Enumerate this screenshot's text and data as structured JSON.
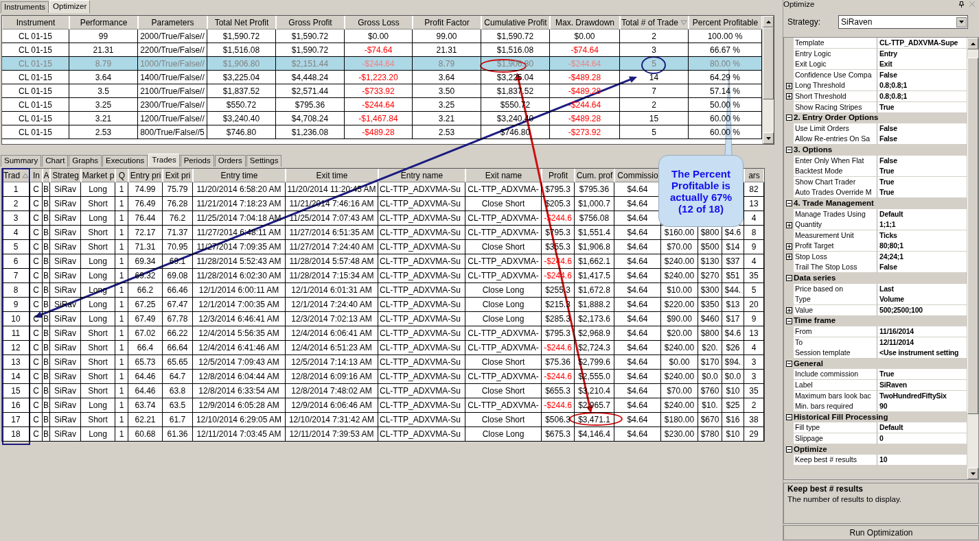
{
  "main_tabs": [
    {
      "label": "Instruments",
      "selected": false
    },
    {
      "label": "Optimizer",
      "selected": true
    }
  ],
  "results_table": {
    "columns": [
      {
        "label": "Instrument"
      },
      {
        "label": "Performance"
      },
      {
        "label": "Parameters"
      },
      {
        "label": "Total Net Profit"
      },
      {
        "label": "Gross Profit"
      },
      {
        "label": "Gross Loss"
      },
      {
        "label": "Profit Factor"
      },
      {
        "label": "Cumulative Profit"
      },
      {
        "label": "Max. Drawdown"
      },
      {
        "label": "Total # of Trade",
        "sort_descending": true
      },
      {
        "label": "Percent Profitable"
      }
    ],
    "rows": [
      {
        "selected": false,
        "cells": [
          "CL 01-15",
          "99",
          "2000/True/False//",
          "$1,590.72",
          "$1,590.72",
          "$0.00",
          "99.00",
          "$1,590.72",
          "$0.00",
          "2",
          "100.00 %"
        ]
      },
      {
        "selected": false,
        "cells": [
          "CL 01-15",
          "21.31",
          "2200/True/False//",
          "$1,516.08",
          "$1,590.72",
          {
            "text": "-$74.64",
            "negative": true
          },
          "21.31",
          "$1,516.08",
          {
            "text": "-$74.64",
            "negative": true
          },
          "3",
          "66.67 %"
        ]
      },
      {
        "selected": true,
        "cells": [
          "CL 01-15",
          "8.79",
          "1000/True/False//",
          "$1,906.80",
          "$2,151.44",
          {
            "text": "-$244.64",
            "negative": true
          },
          "8.79",
          "$1,906.80",
          {
            "text": "-$244.64",
            "negative": true
          },
          "5",
          "80.00 %"
        ]
      },
      {
        "selected": false,
        "cells": [
          "CL 01-15",
          "3.64",
          "1400/True/False//",
          "$3,225.04",
          "$4,448.24",
          {
            "text": "-$1,223.20",
            "negative": true
          },
          "3.64",
          "$3,225.04",
          {
            "text": "-$489.28",
            "negative": true
          },
          "14",
          "64.29 %"
        ]
      },
      {
        "selected": false,
        "cells": [
          "CL 01-15",
          "3.5",
          "2100/True/False//",
          "$1,837.52",
          "$2,571.44",
          {
            "text": "-$733.92",
            "negative": true
          },
          "3.50",
          "$1,837.52",
          {
            "text": "-$489.28",
            "negative": true
          },
          "7",
          "57.14 %"
        ]
      },
      {
        "selected": false,
        "cells": [
          "CL 01-15",
          "3.25",
          "2300/True/False//",
          "$550.72",
          "$795.36",
          {
            "text": "-$244.64",
            "negative": true
          },
          "3.25",
          "$550.72",
          {
            "text": "-$244.64",
            "negative": true
          },
          "2",
          "50.00 %"
        ]
      },
      {
        "selected": false,
        "cells": [
          "CL 01-15",
          "3.21",
          "1200/True/False//",
          "$3,240.40",
          "$4,708.24",
          {
            "text": "-$1,467.84",
            "negative": true
          },
          "3.21",
          "$3,240.40",
          {
            "text": "-$489.28",
            "negative": true
          },
          "15",
          "60.00 %"
        ]
      },
      {
        "selected": false,
        "cells": [
          "CL 01-15",
          "2.53",
          "800/True/False//5",
          "$746.80",
          "$1,236.08",
          {
            "text": "-$489.28",
            "negative": true
          },
          "2.53",
          "$746.80",
          {
            "text": "-$273.92",
            "negative": true
          },
          "5",
          "60.00 %"
        ]
      }
    ]
  },
  "detail_tabs": [
    {
      "label": "Summary",
      "selected": false
    },
    {
      "label": "Chart",
      "selected": false
    },
    {
      "label": "Graphs",
      "selected": false
    },
    {
      "label": "Executions",
      "selected": false
    },
    {
      "label": "Trades",
      "selected": true
    },
    {
      "label": "Periods",
      "selected": false
    },
    {
      "label": "Orders",
      "selected": false
    },
    {
      "label": "Settings",
      "selected": false
    }
  ],
  "trades_table": {
    "columns": [
      {
        "label": "Trad",
        "sort_ascending": true
      },
      {
        "label": "In"
      },
      {
        "label": "A"
      },
      {
        "label": "Strateg"
      },
      {
        "label": "Market p"
      },
      {
        "label": "Q"
      },
      {
        "label": "Entry pri"
      },
      {
        "label": "Exit pri"
      },
      {
        "label": "Entry time"
      },
      {
        "label": "Exit time"
      },
      {
        "label": "Entry name"
      },
      {
        "label": "Exit name"
      },
      {
        "label": "Profit"
      },
      {
        "label": "Cum. prof"
      },
      {
        "label": "Commissio"
      },
      {},
      {},
      {},
      {
        "label": "ars"
      }
    ],
    "rows": [
      [
        "1",
        "C",
        "B",
        "SiRav",
        "Long",
        "1",
        "74.99",
        "75.79",
        "11/20/2014 6:58:20 AM",
        "11/20/2014 11:20:45 AM",
        "CL-TTP_ADXVMA-Su",
        "CL-TTP_ADXVMA-",
        "$795.3",
        "$795.36",
        "$4.64",
        null,
        null,
        null,
        "82"
      ],
      [
        "2",
        "C",
        "B",
        "SiRav",
        "Short",
        "1",
        "76.49",
        "76.28",
        "11/21/2014 7:18:23 AM",
        "11/21/2014 7:46:16 AM",
        "CL-TTP_ADXVMA-Su",
        "Close Short",
        "$205.3",
        "$1,000.7",
        "$4.64",
        null,
        null,
        null,
        "13"
      ],
      [
        "3",
        "C",
        "B",
        "SiRav",
        "Long",
        "1",
        "76.44",
        "76.2",
        "11/25/2014 7:04:18 AM",
        "11/25/2014 7:07:43 AM",
        "CL-TTP_ADXVMA-Su",
        "CL-TTP_ADXVMA-",
        {
          "text": "-$244.6",
          "negative": true
        },
        "$756.08",
        "$4.64",
        null,
        null,
        null,
        "4"
      ],
      [
        "4",
        "C",
        "B",
        "SiRav",
        "Short",
        "1",
        "72.17",
        "71.37",
        "11/27/2014 6:48:11 AM",
        "11/27/2014 6:51:35 AM",
        "CL-TTP_ADXVMA-Su",
        "CL-TTP_ADXVMA-",
        "$795.3",
        "$1,551.4",
        "$4.64",
        "$160.00",
        "$800",
        "$4.6",
        "8"
      ],
      [
        "5",
        "C",
        "B",
        "SiRav",
        "Short",
        "1",
        "71.31",
        "70.95",
        "11/27/2014 7:09:35 AM",
        "11/27/2014 7:24:40 AM",
        "CL-TTP_ADXVMA-Su",
        "Close Short",
        "$355.3",
        "$1,906.8",
        "$4.64",
        "$70.00",
        "$500",
        "$14",
        "9"
      ],
      [
        "6",
        "C",
        "B",
        "SiRav",
        "Long",
        "1",
        "69.34",
        "69.1",
        "11/28/2014 5:52:43 AM",
        "11/28/2014 5:57:48 AM",
        "CL-TTP_ADXVMA-Su",
        "CL-TTP_ADXVMA-",
        {
          "text": "-$244.6",
          "negative": true
        },
        "$1,662.1",
        "$4.64",
        "$240.00",
        "$130",
        "$37",
        "4"
      ],
      [
        "7",
        "C",
        "B",
        "SiRav",
        "Long",
        "1",
        "69.32",
        "69.08",
        "11/28/2014 6:02:30 AM",
        "11/28/2014 7:15:34 AM",
        "CL-TTP_ADXVMA-Su",
        "CL-TTP_ADXVMA-",
        {
          "text": "-$244.6",
          "negative": true
        },
        "$1,417.5",
        "$4.64",
        "$240.00",
        "$270",
        "$51",
        "35"
      ],
      [
        "8",
        "C",
        "B",
        "SiRav",
        "Long",
        "1",
        "66.2",
        "66.46",
        "12/1/2014 6:00:11 AM",
        "12/1/2014 6:01:31 AM",
        "CL-TTP_ADXVMA-Su",
        "Close Long",
        "$255.3",
        "$1,672.8",
        "$4.64",
        "$10.00",
        "$300",
        "$44.",
        "5"
      ],
      [
        "9",
        "C",
        "B",
        "SiRav",
        "Long",
        "1",
        "67.25",
        "67.47",
        "12/1/2014 7:00:35 AM",
        "12/1/2014 7:24:40 AM",
        "CL-TTP_ADXVMA-Su",
        "Close Long",
        "$215.3",
        "$1,888.2",
        "$4.64",
        "$220.00",
        "$350",
        "$13",
        "20"
      ],
      [
        "10",
        "C",
        "B",
        "SiRav",
        "Long",
        "1",
        "67.49",
        "67.78",
        "12/3/2014 6:46:41 AM",
        "12/3/2014 7:02:13 AM",
        "CL-TTP_ADXVMA-Su",
        "Close Long",
        "$285.3",
        "$2,173.6",
        "$4.64",
        "$90.00",
        "$460",
        "$17",
        "9"
      ],
      [
        "11",
        "C",
        "B",
        "SiRav",
        "Short",
        "1",
        "67.02",
        "66.22",
        "12/4/2014 5:56:35 AM",
        "12/4/2014 6:06:41 AM",
        "CL-TTP_ADXVMA-Su",
        "CL-TTP_ADXVMA-",
        "$795.3",
        "$2,968.9",
        "$4.64",
        "$20.00",
        "$800",
        "$4.6",
        "13"
      ],
      [
        "12",
        "C",
        "B",
        "SiRav",
        "Short",
        "1",
        "66.4",
        "66.64",
        "12/4/2014 6:41:46 AM",
        "12/4/2014 6:51:23 AM",
        "CL-TTP_ADXVMA-Su",
        "CL-TTP_ADXVMA-",
        {
          "text": "-$244.6",
          "negative": true
        },
        "$2,724.3",
        "$4.64",
        "$240.00",
        "$20.",
        "$26",
        "4"
      ],
      [
        "13",
        "C",
        "B",
        "SiRav",
        "Short",
        "1",
        "65.73",
        "65.65",
        "12/5/2014 7:09:43 AM",
        "12/5/2014 7:14:13 AM",
        "CL-TTP_ADXVMA-Su",
        "Close Short",
        "$75.36",
        "$2,799.6",
        "$4.64",
        "$0.00",
        "$170",
        "$94.",
        "3"
      ],
      [
        "14",
        "C",
        "B",
        "SiRav",
        "Short",
        "1",
        "64.46",
        "64.7",
        "12/8/2014 6:04:44 AM",
        "12/8/2014 6:09:16 AM",
        "CL-TTP_ADXVMA-Su",
        "CL-TTP_ADXVMA-",
        {
          "text": "-$244.6",
          "negative": true
        },
        "$2,555.0",
        "$4.64",
        "$240.00",
        "$0.0",
        "$0.0",
        "3"
      ],
      [
        "15",
        "C",
        "B",
        "SiRav",
        "Short",
        "1",
        "64.46",
        "63.8",
        "12/8/2014 6:33:54 AM",
        "12/8/2014 7:48:02 AM",
        "CL-TTP_ADXVMA-Su",
        "Close Short",
        "$655.3",
        "$3,210.4",
        "$4.64",
        "$70.00",
        "$760",
        "$10",
        "35"
      ],
      [
        "16",
        "C",
        "B",
        "SiRav",
        "Long",
        "1",
        "63.74",
        "63.5",
        "12/9/2014 6:05:28 AM",
        "12/9/2014 6:06:46 AM",
        "CL-TTP_ADXVMA-Su",
        "CL-TTP_ADXVMA-",
        {
          "text": "-$244.6",
          "negative": true
        },
        "$2,965.7",
        "$4.64",
        "$240.00",
        "$10.",
        "$25",
        "2"
      ],
      [
        "17",
        "C",
        "B",
        "SiRav",
        "Short",
        "1",
        "62.21",
        "61.7",
        "12/10/2014 6:29:05 AM",
        "12/10/2014 7:31:42 AM",
        "CL-TTP_ADXVMA-Su",
        "Close Short",
        "$506.3",
        "$3,471.1",
        "$4.64",
        "$180.00",
        "$670",
        "$16",
        "38"
      ],
      [
        "18",
        "C",
        "B",
        "SiRav",
        "Long",
        "1",
        "60.68",
        "61.36",
        "12/11/2014 7:03:45 AM",
        "12/11/2014 7:39:53 AM",
        "CL-TTP_ADXVMA-Su",
        "Close Long",
        "$675.3",
        "$4,146.4",
        "$4.64",
        "$230.00",
        "$780",
        "$10",
        "29"
      ]
    ]
  },
  "callout": {
    "text": "The Percent Profitable is actually 67% (12 of 18)"
  },
  "optimize_panel": {
    "title": "Optimize",
    "strategy_label": "Strategy:",
    "strategy_value": "SiRaven",
    "top_items": [
      {
        "name": "Template",
        "value": "CL-TTP_ADXVMA-Supe",
        "expandable": false
      },
      {
        "name": "Entry Logic",
        "value": "Entry",
        "expandable": false
      },
      {
        "name": "Exit Logic",
        "value": "Exit",
        "expandable": false
      },
      {
        "name": "Confidence Use Compa",
        "value": "False",
        "expandable": false
      },
      {
        "name": "Long Threshold",
        "value": "0.8;0.8;1",
        "expandable": true
      },
      {
        "name": "Short Threshold",
        "value": "0.8;0.8;1",
        "expandable": true
      },
      {
        "name": "Show Racing Stripes",
        "value": "True",
        "expandable": false
      }
    ],
    "categories": [
      {
        "name": "2. Entry Order Options",
        "expanded": true,
        "children": [
          {
            "name": "Use Limit Orders",
            "value": "False",
            "expandable": false
          },
          {
            "name": "Allow Re-entries On Sa",
            "value": "False",
            "expandable": false
          }
        ]
      },
      {
        "name": "3. Options",
        "expanded": true,
        "children": [
          {
            "name": "Enter Only When Flat",
            "value": "False",
            "expandable": false
          },
          {
            "name": "Backtest Mode",
            "value": "True",
            "expandable": false
          },
          {
            "name": "Show Chart Trader",
            "value": "True",
            "expandable": false
          },
          {
            "name": "Auto Trades Override M",
            "value": "True",
            "expandable": false
          }
        ]
      },
      {
        "name": "4. Trade Management",
        "expanded": true,
        "children": [
          {
            "name": "Manage Trades Using",
            "value": "Default",
            "expandable": false
          },
          {
            "name": "Quantity",
            "value": "1;1;1",
            "expandable": true
          },
          {
            "name": "Measurement Unit",
            "value": "Ticks",
            "expandable": false
          },
          {
            "name": "Profit Target",
            "value": "80;80;1",
            "expandable": true
          },
          {
            "name": "Stop Loss",
            "value": "24;24;1",
            "expandable": true
          },
          {
            "name": "Trail The Stop Loss",
            "value": "False",
            "expandable": false
          }
        ]
      },
      {
        "name": "Data series",
        "expanded": true,
        "children": [
          {
            "name": "Price based on",
            "value": "Last",
            "expandable": false
          },
          {
            "name": "Type",
            "value": "Volume",
            "expandable": false
          },
          {
            "name": "Value",
            "value": "500;2500;100",
            "expandable": true
          }
        ]
      },
      {
        "name": "Time frame",
        "expanded": true,
        "children": [
          {
            "name": "From",
            "value": "11/16/2014",
            "expandable": false
          },
          {
            "name": "To",
            "value": "12/11/2014",
            "expandable": false
          },
          {
            "name": "Session template",
            "value": "<Use instrument setting",
            "expandable": false
          }
        ]
      },
      {
        "name": "General",
        "expanded": true,
        "children": [
          {
            "name": "Include commission",
            "value": "True",
            "expandable": false
          },
          {
            "name": "Label",
            "value": "SiRaven",
            "expandable": false
          },
          {
            "name": "Maximum bars look bac",
            "value": "TwoHundredFiftySix",
            "expandable": false
          },
          {
            "name": "Min. bars required",
            "value": "90",
            "expandable": false
          }
        ]
      },
      {
        "name": "Historical Fill Processing",
        "expanded": true,
        "children": [
          {
            "name": "Fill type",
            "value": "Default",
            "expandable": false
          },
          {
            "name": "Slippage",
            "value": "0",
            "expandable": false
          }
        ]
      },
      {
        "name": "Optimize",
        "expanded": true,
        "children": [
          {
            "name": "Keep best # results",
            "value": "10",
            "expandable": false
          }
        ]
      }
    ],
    "description_title": "Keep best # results",
    "description_text": "The number of results to display.",
    "run_button": "Run Optimization"
  }
}
